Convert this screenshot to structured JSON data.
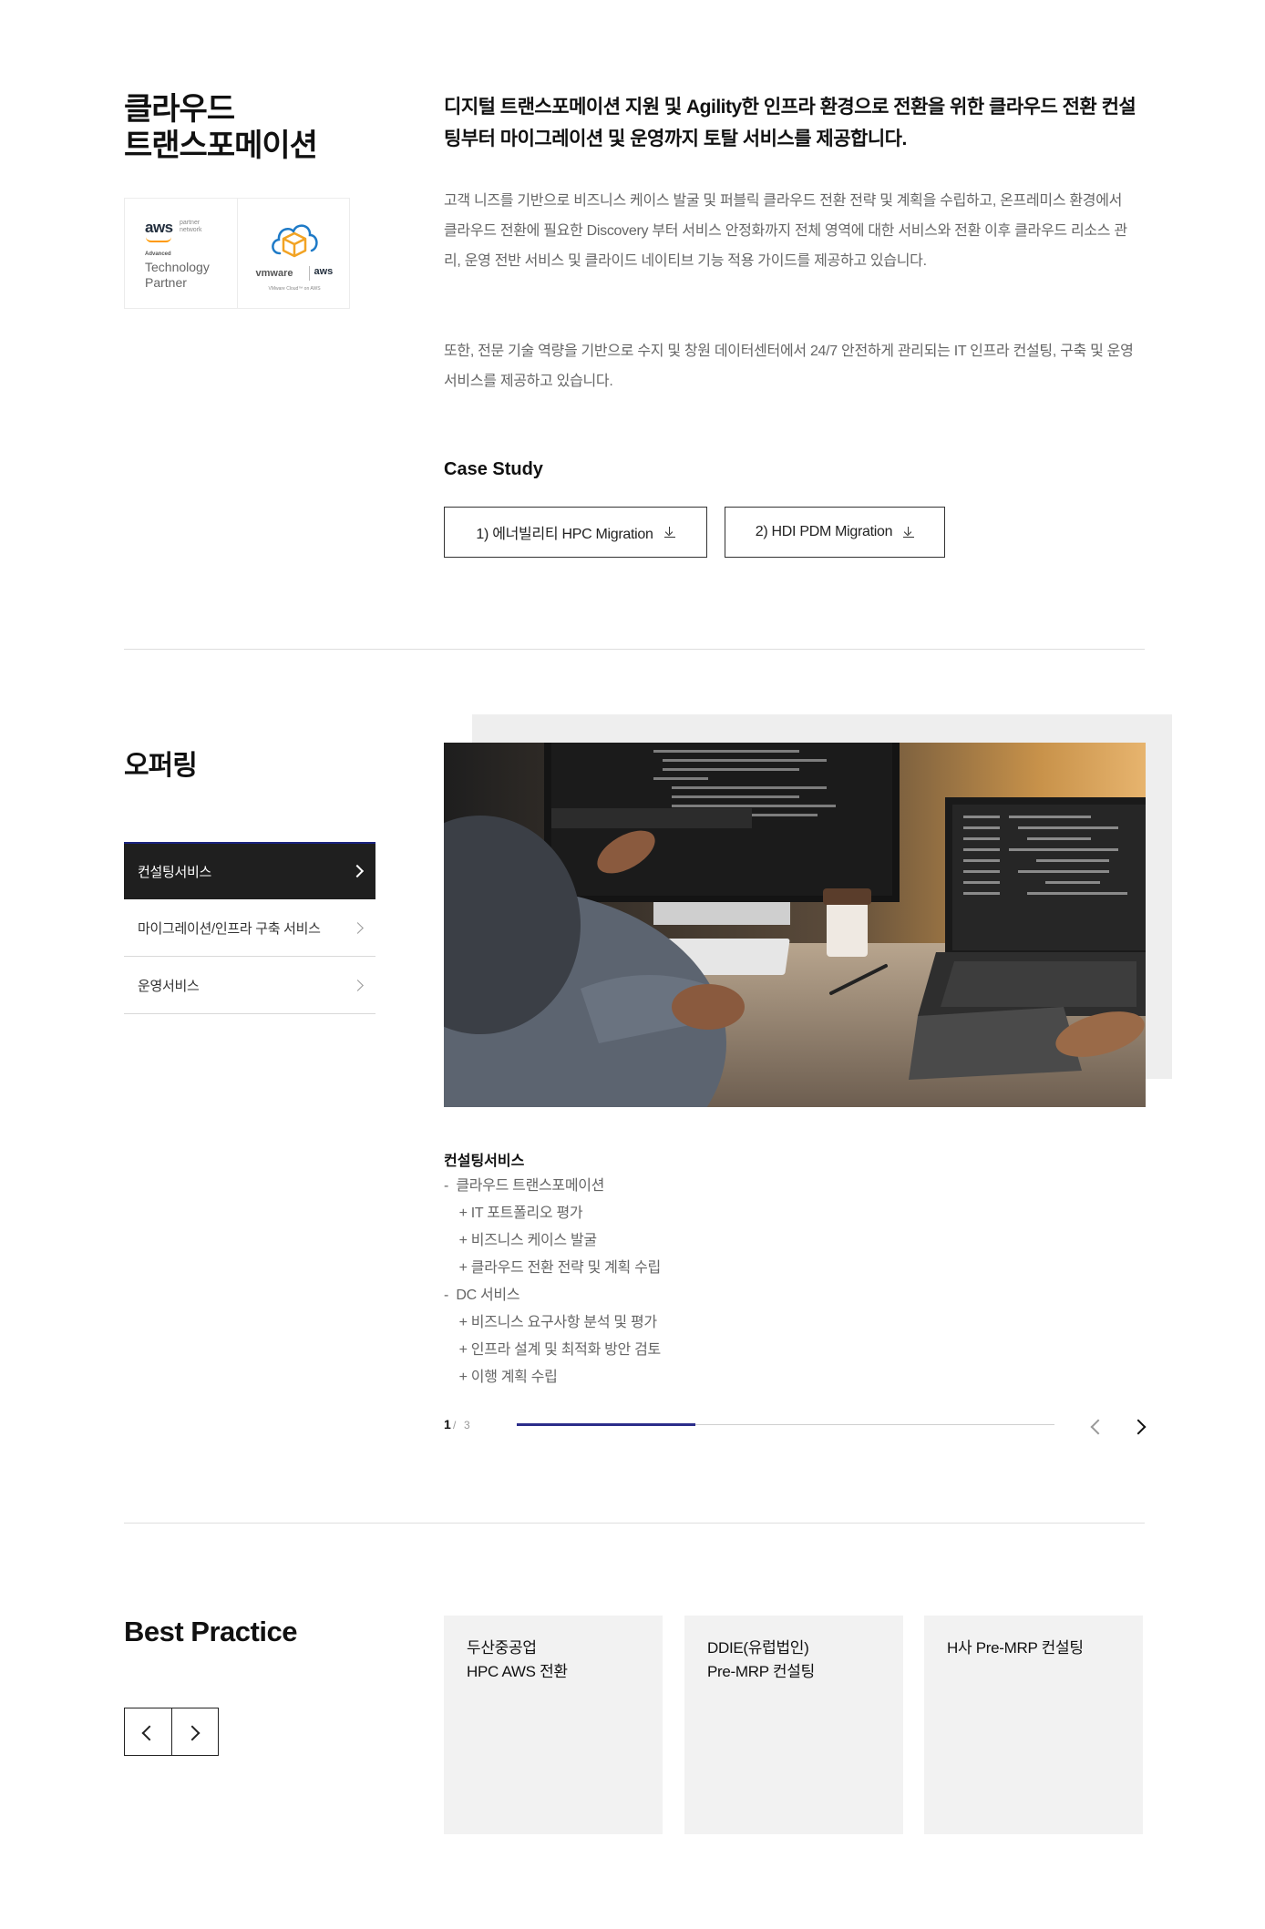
{
  "intro": {
    "title_line1": "클라우드",
    "title_line2": "트랜스포메이션",
    "lead": "디지털 트랜스포메이션 지원 및 Agility한 인프라 환경으로 전환을 위한 클라우드 전환 컨설팅부터 마이그레이션 및 운영까지 토탈 서비스를 제공합니다.",
    "paragraph1": "고객 니즈를 기반으로 비즈니스 케이스 발굴 및 퍼블릭 클라우드 전환 전략 및 계획을 수립하고, 온프레미스 환경에서 클라우드 전환에 필요한 Discovery 부터 서비스 안정화까지 전체 영역에 대한 서비스와 전환 이후 클라우드 리소스 관리, 운영 전반 서비스 및 클라이드 네이티브 기능 적용 가이드를 제공하고 있습니다.",
    "paragraph2": "또한, 전문 기술 역량을 기반으로 수지 및 창원 데이터센터에서 24/7 안전하게 관리되는 IT 인프라 컨설팅, 구축 및 운영 서비스를 제공하고 있습니다.",
    "partner_badges": {
      "aws_logo_text": "aws",
      "aws_partner_network": "partner network",
      "aws_advanced": "Advanced",
      "aws_tier": "Technology Partner",
      "vmware_logo_text": "vmware",
      "vmware_aws_text": "aws",
      "vmware_sub": "VMware Cloud™ on AWS"
    },
    "case_study": {
      "title": "Case Study",
      "buttons": [
        {
          "label": "1) 에너빌리티 HPC Migration"
        },
        {
          "label": "2) HDI PDM Migration"
        }
      ]
    }
  },
  "offering": {
    "title": "오퍼링",
    "menu": [
      {
        "label": "컨설팅서비스",
        "active": true
      },
      {
        "label": "마이그레이션/인프라 구축 서비스",
        "active": false
      },
      {
        "label": "운영서비스",
        "active": false
      }
    ],
    "slide_title": "컨설팅서비스",
    "slide_items": [
      "-  클라우드 트랜스포메이션",
      "    + IT 포트폴리오 평가",
      "    + 비즈니스 케이스 발굴",
      "    + 클라우드 전환 전략 및 계획 수립",
      "-  DC 서비스",
      "    + 비즈니스 요구사항 분석 및 평가",
      "    + 인프라 설계 및 최적화 방안 검토",
      "    + 이행 계획 수립"
    ],
    "pager": {
      "current": "1",
      "separator": "/",
      "total": "3",
      "progress": 0.333
    }
  },
  "best_practice": {
    "title": "Best Practice",
    "cards": [
      {
        "line1": "두산중공업",
        "line2": "HPC AWS 전환"
      },
      {
        "line1": "DDIE(유럽법인)",
        "line2": "Pre-MRP 컨설팅"
      },
      {
        "line1": "H사 Pre-MRP 컨설팅",
        "line2": ""
      }
    ]
  },
  "colors": {
    "accent": "#2b2d8a",
    "active_menu_bg": "#1f1f1f",
    "aws_orange": "#ff9900"
  }
}
